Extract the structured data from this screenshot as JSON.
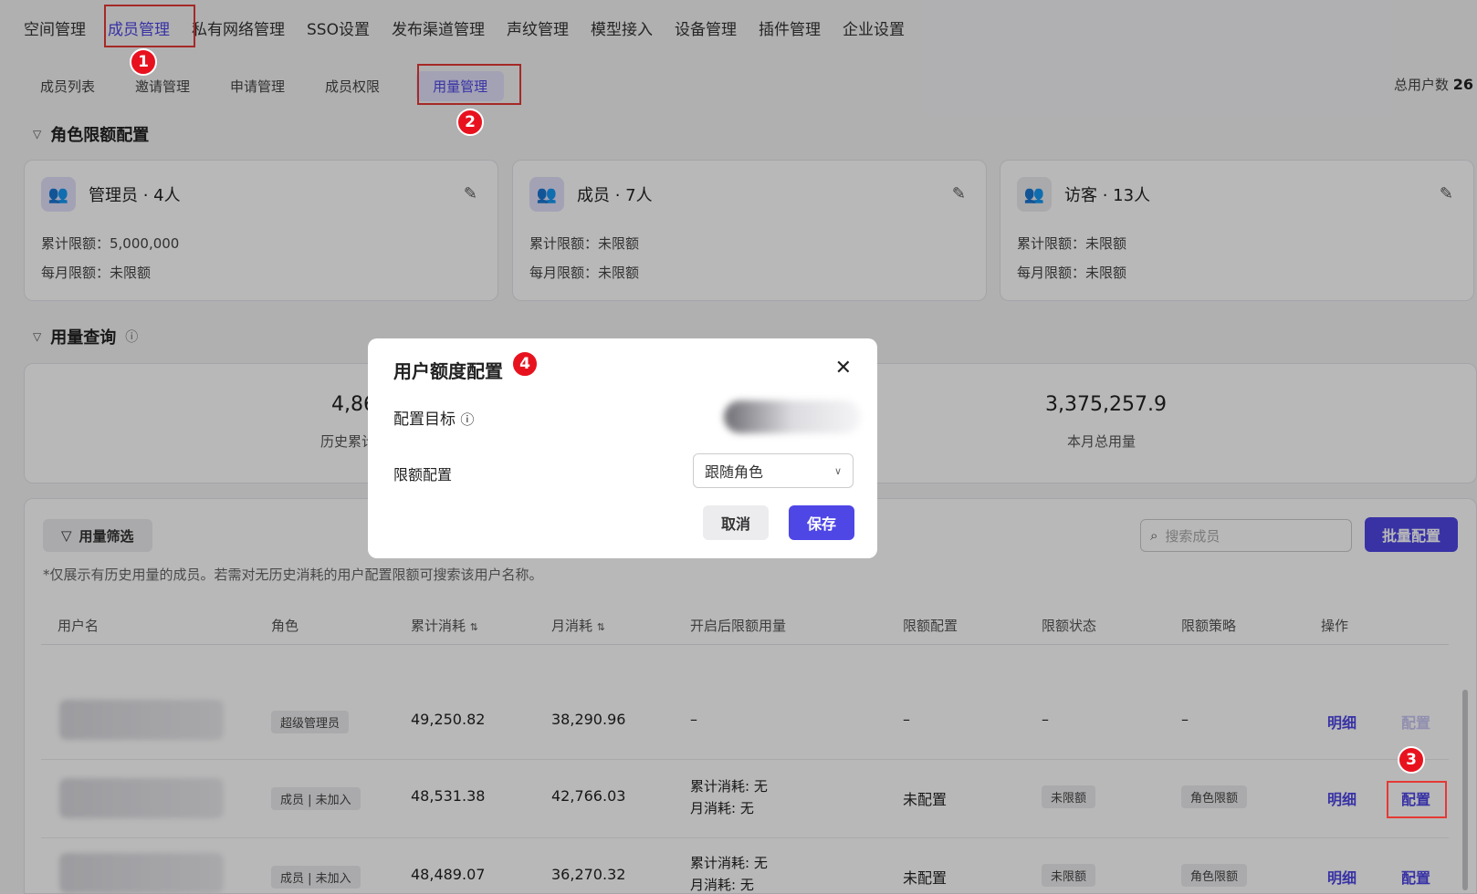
{
  "top_nav": [
    "空间管理",
    "成员管理",
    "私有网络管理",
    "SSO设置",
    "发布渠道管理",
    "声纹管理",
    "模型接入",
    "设备管理",
    "插件管理",
    "企业设置"
  ],
  "top_nav_active": "成员管理",
  "sub_nav": [
    "成员列表",
    "邀请管理",
    "申请管理",
    "成员权限",
    "用量管理"
  ],
  "sub_nav_active": "用量管理",
  "total_users_label": "总用户数",
  "total_users_value": "26",
  "badges": [
    "1",
    "2",
    "3",
    "4"
  ],
  "role_section_title": "角色限额配置",
  "role_cards": [
    {
      "name": "管理员 · 4人",
      "cumulative": "累计限额：5,000,000",
      "monthly": "每月限额：未限额"
    },
    {
      "name": "成员 · 7人",
      "cumulative": "累计限额：未限额",
      "monthly": "每月限额：未限额"
    },
    {
      "name": "访客 · 13人",
      "cumulative": "累计限额：未限额",
      "monthly": "每月限额：未限额"
    }
  ],
  "usage_section_title": "用量查询",
  "stats": [
    {
      "value": "4,86",
      "label": "历史累计"
    },
    {
      "value": "3,375,257.9",
      "label": "本月总用量"
    }
  ],
  "filter_button": "用量筛选",
  "search_placeholder": "搜索成员",
  "batch_button": "批量配置",
  "hint": "*仅展示有历史用量的成员。若需对无历史消耗的用户配置限额可搜索该用户名称。",
  "columns": [
    "用户名",
    "角色",
    "累计消耗",
    "月消耗",
    "开启后限额用量",
    "限额配置",
    "限额状态",
    "限额策略",
    "操作"
  ],
  "rows": [
    {
      "role": "超级管理员",
      "cumulative": "49,250.82",
      "monthly": "38,290.96",
      "limit_usage": "–",
      "limit_config": "–",
      "limit_status": "–",
      "strategy": "–",
      "detail": "明细",
      "config": "配置",
      "config_enabled": false
    },
    {
      "role": "成员 | 未加入",
      "cumulative": "48,531.38",
      "monthly": "42,766.03",
      "limit_usage_1": "累计消耗: 无",
      "limit_usage_2": "月消耗: 无",
      "limit_config": "未配置",
      "limit_status": "未限额",
      "strategy": "角色限额",
      "detail": "明细",
      "config": "配置",
      "config_enabled": true
    },
    {
      "role": "成员 | 未加入",
      "cumulative": "48,489.07",
      "monthly": "36,270.32",
      "limit_usage_1": "累计消耗: 无",
      "limit_usage_2": "月消耗: 无",
      "limit_config": "未配置",
      "limit_status": "未限额",
      "strategy": "角色限额",
      "detail": "明细",
      "config": "配置",
      "config_enabled": true
    }
  ],
  "modal": {
    "title": "用户额度配置",
    "target_label": "配置目标",
    "limit_label": "限额配置",
    "limit_value": "跟随角色",
    "cancel": "取消",
    "save": "保存"
  },
  "colors": {
    "accent": "#4e46e5",
    "annotation_red": "#e8121e"
  }
}
